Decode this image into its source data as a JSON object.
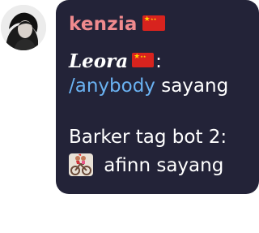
{
  "message": {
    "sender": "kenzia",
    "mention_name": "Leora",
    "mention_suffix": ":",
    "command": "/anybody",
    "command_suffix": " sayang",
    "line3": "Barker tag bot 2:",
    "line4": " afinn sayang"
  },
  "icons": {
    "sender_flag": "china-flag-icon",
    "mention_flag": "china-flag-icon",
    "emoji": "couple-on-bicycle-icon"
  },
  "colors": {
    "bubble": "#232338",
    "sender": "#ef8a8e",
    "command": "#6ab2f2",
    "text": "#ffffff",
    "flag": "#d8231e"
  }
}
